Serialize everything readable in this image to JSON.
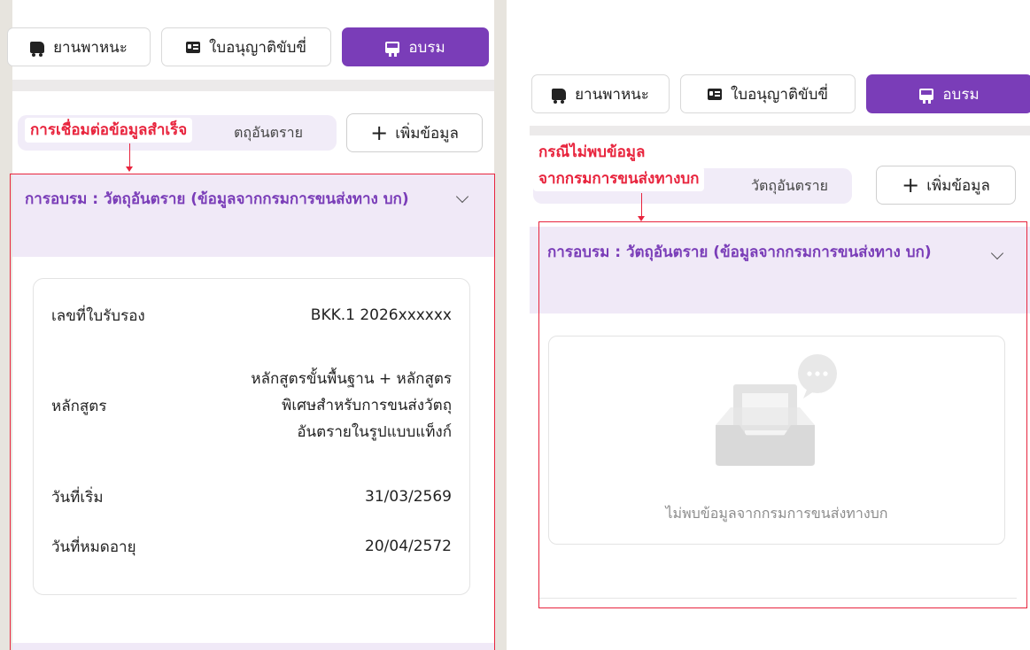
{
  "tabs": {
    "vehicle": "ยานพาหนะ",
    "license": "ใบอนุญาติขับขี่",
    "training": "อบรม"
  },
  "chip": {
    "left_text": "ตถุอันตราย",
    "right_text": "วัตถุอันตราย"
  },
  "add_button": "เพิ่มข้อมูล",
  "annotations": {
    "success": "การเชื่อมต่อข้อมูลสำเร็จ",
    "not_found_line1": "กรณีไม่พบข้อมูล",
    "not_found_line2": "จากกรมการขนส่งทางบก"
  },
  "accordion_title": "การอบรม : วัตถุอันตราย (ข้อมูลจากกรมการขนส่งทาง บก)",
  "details": [
    {
      "label": "เลขที่ใบรับรอง",
      "value": "BKK.1 2026xxxxxx"
    },
    {
      "label": "หลักสูตร",
      "value": "หลักสูตรขั้นพื้นฐาน + หลักสูตรพิเศษสำหรับการขนส่งวัตถุอันตรายในรูปแบบแท็งก์"
    },
    {
      "label": "วันที่เริ่ม",
      "value": "31/03/2569"
    },
    {
      "label": "วันที่หมดอายุ",
      "value": "20/04/2572"
    }
  ],
  "empty_message": "ไม่พบข้อมูลจากกรมการขนส่งทางบก",
  "colors": {
    "primary": "#7a3db8",
    "accordion_bg": "#f0e9f7",
    "annotation_red": "#e8243d"
  },
  "icons": {
    "vehicle": "truck-icon",
    "license": "id-card-icon",
    "training": "training-icon",
    "add": "plus-icon",
    "expand": "chevron-down-icon",
    "empty": "empty-inbox-icon"
  }
}
